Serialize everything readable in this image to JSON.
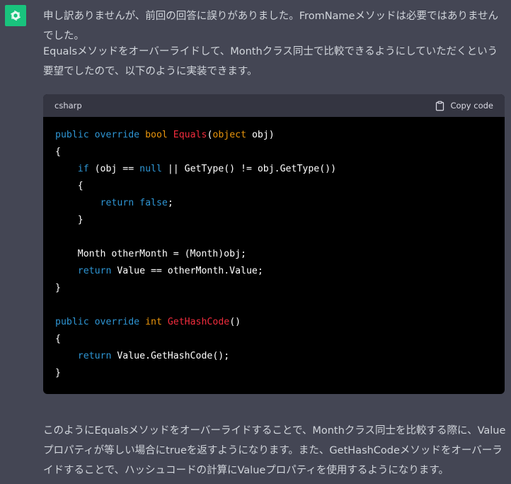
{
  "assistant": {
    "avatar_icon": "openai-logo-icon",
    "avatar_color": "#19c37d"
  },
  "message": {
    "paragraph1": "申し訳ありませんが、前回の回答に誤りがありました。FromNameメソッドは必要ではありませんでした。",
    "paragraph2": "Equalsメソッドをオーバーライドして、Monthクラス同士で比較できるようにしていただくという要望でしたので、以下のように実装できます。",
    "paragraph3": "このようにEqualsメソッドをオーバーライドすることで、Monthクラス同士を比較する際に、Valueプロパティが等しい場合にtrueを返すようになります。また、GetHashCodeメソッドをオーバーライドすることで、ハッシュコードの計算にValueプロパティを使用するようになります。"
  },
  "code_block": {
    "language": "csharp",
    "copy_label": "Copy code",
    "copy_icon": "clipboard-icon",
    "colors": {
      "keyword": "#2e95d3",
      "type": "#e9950c",
      "function": "#f22c3d",
      "plain": "#ffffff"
    },
    "lines": [
      [
        [
          "kw",
          "public"
        ],
        [
          "pl",
          " "
        ],
        [
          "kw",
          "override"
        ],
        [
          "pl",
          " "
        ],
        [
          "ty",
          "bool"
        ],
        [
          "pl",
          " "
        ],
        [
          "fn",
          "Equals"
        ],
        [
          "pl",
          "("
        ],
        [
          "ty",
          "object"
        ],
        [
          "pl",
          " obj)"
        ]
      ],
      [
        [
          "pl",
          "{"
        ]
      ],
      [
        [
          "pl",
          "    "
        ],
        [
          "kw",
          "if"
        ],
        [
          "pl",
          " (obj == "
        ],
        [
          "kw",
          "null"
        ],
        [
          "pl",
          " || GetType() != obj.GetType())"
        ]
      ],
      [
        [
          "pl",
          "    {"
        ]
      ],
      [
        [
          "pl",
          "        "
        ],
        [
          "kw",
          "return"
        ],
        [
          "pl",
          " "
        ],
        [
          "kw",
          "false"
        ],
        [
          "pl",
          ";"
        ]
      ],
      [
        [
          "pl",
          "    }"
        ]
      ],
      [],
      [
        [
          "pl",
          "    Month otherMonth = (Month)obj;"
        ]
      ],
      [
        [
          "pl",
          "    "
        ],
        [
          "kw",
          "return"
        ],
        [
          "pl",
          " Value == otherMonth.Value;"
        ]
      ],
      [
        [
          "pl",
          "}"
        ]
      ],
      [],
      [
        [
          "kw",
          "public"
        ],
        [
          "pl",
          " "
        ],
        [
          "kw",
          "override"
        ],
        [
          "pl",
          " "
        ],
        [
          "ty",
          "int"
        ],
        [
          "pl",
          " "
        ],
        [
          "fn",
          "GetHashCode"
        ],
        [
          "pl",
          "()"
        ]
      ],
      [
        [
          "pl",
          "{"
        ]
      ],
      [
        [
          "pl",
          "    "
        ],
        [
          "kw",
          "return"
        ],
        [
          "pl",
          " Value.GetHashCode();"
        ]
      ],
      [
        [
          "pl",
          "}"
        ]
      ]
    ]
  }
}
